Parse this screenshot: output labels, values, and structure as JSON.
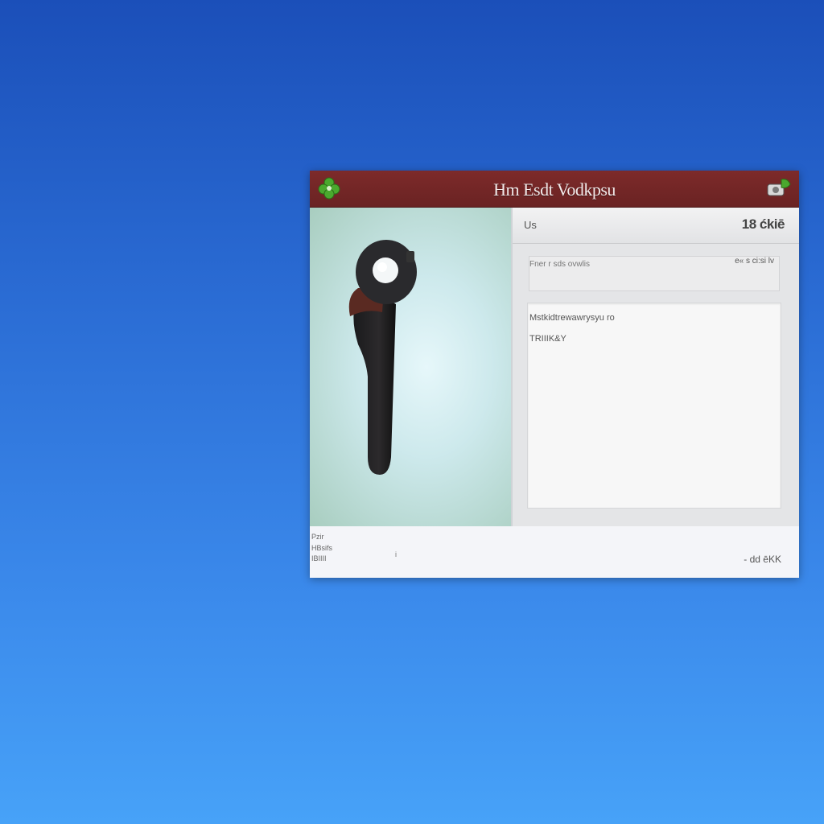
{
  "window": {
    "title": "Hm Esdt Vodkpsu",
    "icons": {
      "app": "clover-icon",
      "corner": "camera-icon"
    }
  },
  "image_pane": {
    "subject": "camera-strap-icon"
  },
  "right_pane": {
    "header_left": "Us",
    "header_right": "18 ćkiē",
    "field_label": "Fner r sds ovwlis",
    "field_value": "e« s ci:si lv",
    "content_line1": "Mstkidtrewawrysyu ro",
    "content_line2": "TRIIIK&Y"
  },
  "status_bar": {
    "line1": "Pzir",
    "line2": "HBsifs",
    "line3": "IBIIII",
    "mid": "i",
    "right": "- dd ēKK"
  },
  "colors": {
    "desktop_top": "#1b4fb9",
    "desktop_bottom": "#47a2f8",
    "titlebar": "#7d2a2a",
    "accent_green": "#3f9a2a"
  }
}
